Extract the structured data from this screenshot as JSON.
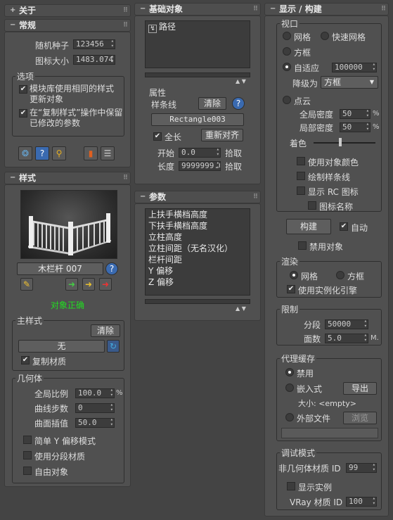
{
  "about": {
    "title": "关于"
  },
  "general": {
    "title": "常规",
    "seed_label": "随机种子",
    "seed_value": "123456",
    "icon_size_label": "图标大小",
    "icon_size_value": "1483.074",
    "options_label": "选项",
    "opt1": "模块库使用相同的样式更新对象",
    "opt2": "在“复制样式”操作中保留已修改的参数"
  },
  "style": {
    "title": "样式",
    "name": "木栏杆 007",
    "status": "对象正确",
    "status_color": "#22dd22",
    "main_style": "主样式",
    "clear": "清除",
    "none": "无",
    "copy_material": "复制材质",
    "geometry": "几何体",
    "global_scale_label": "全局比例",
    "global_scale": "100.0",
    "curve_steps_label": "曲线步数",
    "curve_steps": "0",
    "surface_interp_label": "曲面插值",
    "surface_interp": "50.0",
    "simple_y": "简单 Y 偏移模式",
    "use_segment_mat": "使用分段材质",
    "free_object": "自由对象",
    "percent": "%"
  },
  "base": {
    "title": "基础对象",
    "path_item": "路径",
    "attr": "属性",
    "spline_label": "样条线",
    "clear": "清除",
    "spline_value": "Rectangle003",
    "full_length": "全长",
    "realign": "重新对齐",
    "start_label": "开始",
    "start_value": "0.0",
    "pick": "拾取",
    "length_label": "长度",
    "length_value": "9999999.0",
    "pick2": "拾取"
  },
  "params": {
    "title": "参数",
    "items": [
      "上扶手横档高度",
      "下扶手横档高度",
      "立柱高度",
      "立柱间距（无名汉化）",
      "栏杆间距",
      "Y 偏移",
      "Z 偏移"
    ]
  },
  "display": {
    "title": "显示 / 构建",
    "viewport": "视口",
    "grid": "网格",
    "fast_grid": "快速网格",
    "box": "方框",
    "adaptive": "自适应",
    "adaptive_value": "100000",
    "degrade_label": "降级为",
    "degrade_value": "方框",
    "point_cloud": "点云",
    "global_density_label": "全局密度",
    "global_density": "50",
    "local_density_label": "局部密度",
    "local_density": "50",
    "color_label": "着色",
    "use_obj_color": "使用对象颜色",
    "draw_spline": "绘制样条线",
    "show_rc_icon": "显示 RC 图标",
    "icon_name": "图标名称",
    "build": "构建",
    "auto": "自动",
    "disable_obj": "禁用对象",
    "render": "渲染",
    "r_grid": "网格",
    "r_box": "方框",
    "use_instancing": "使用实例化引擎",
    "limit": "限制",
    "segments_label": "分段",
    "segments": "50000",
    "faces_label": "面数",
    "faces": "5.0",
    "faces_unit": "M.",
    "proxy_cache": "代理缓存",
    "disable": "禁用",
    "embed": "嵌入式",
    "export": "导出",
    "size_label": "大小: <empty>",
    "external_file": "外部文件",
    "browse": "浏览",
    "debug": "调试模式",
    "non_geo_label": "非几何体材质 ID",
    "non_geo_value": "99",
    "show_instances": "显示实例",
    "vray_id_label": "VRay 材质 ID",
    "vray_id_value": "100",
    "percent": "%"
  }
}
